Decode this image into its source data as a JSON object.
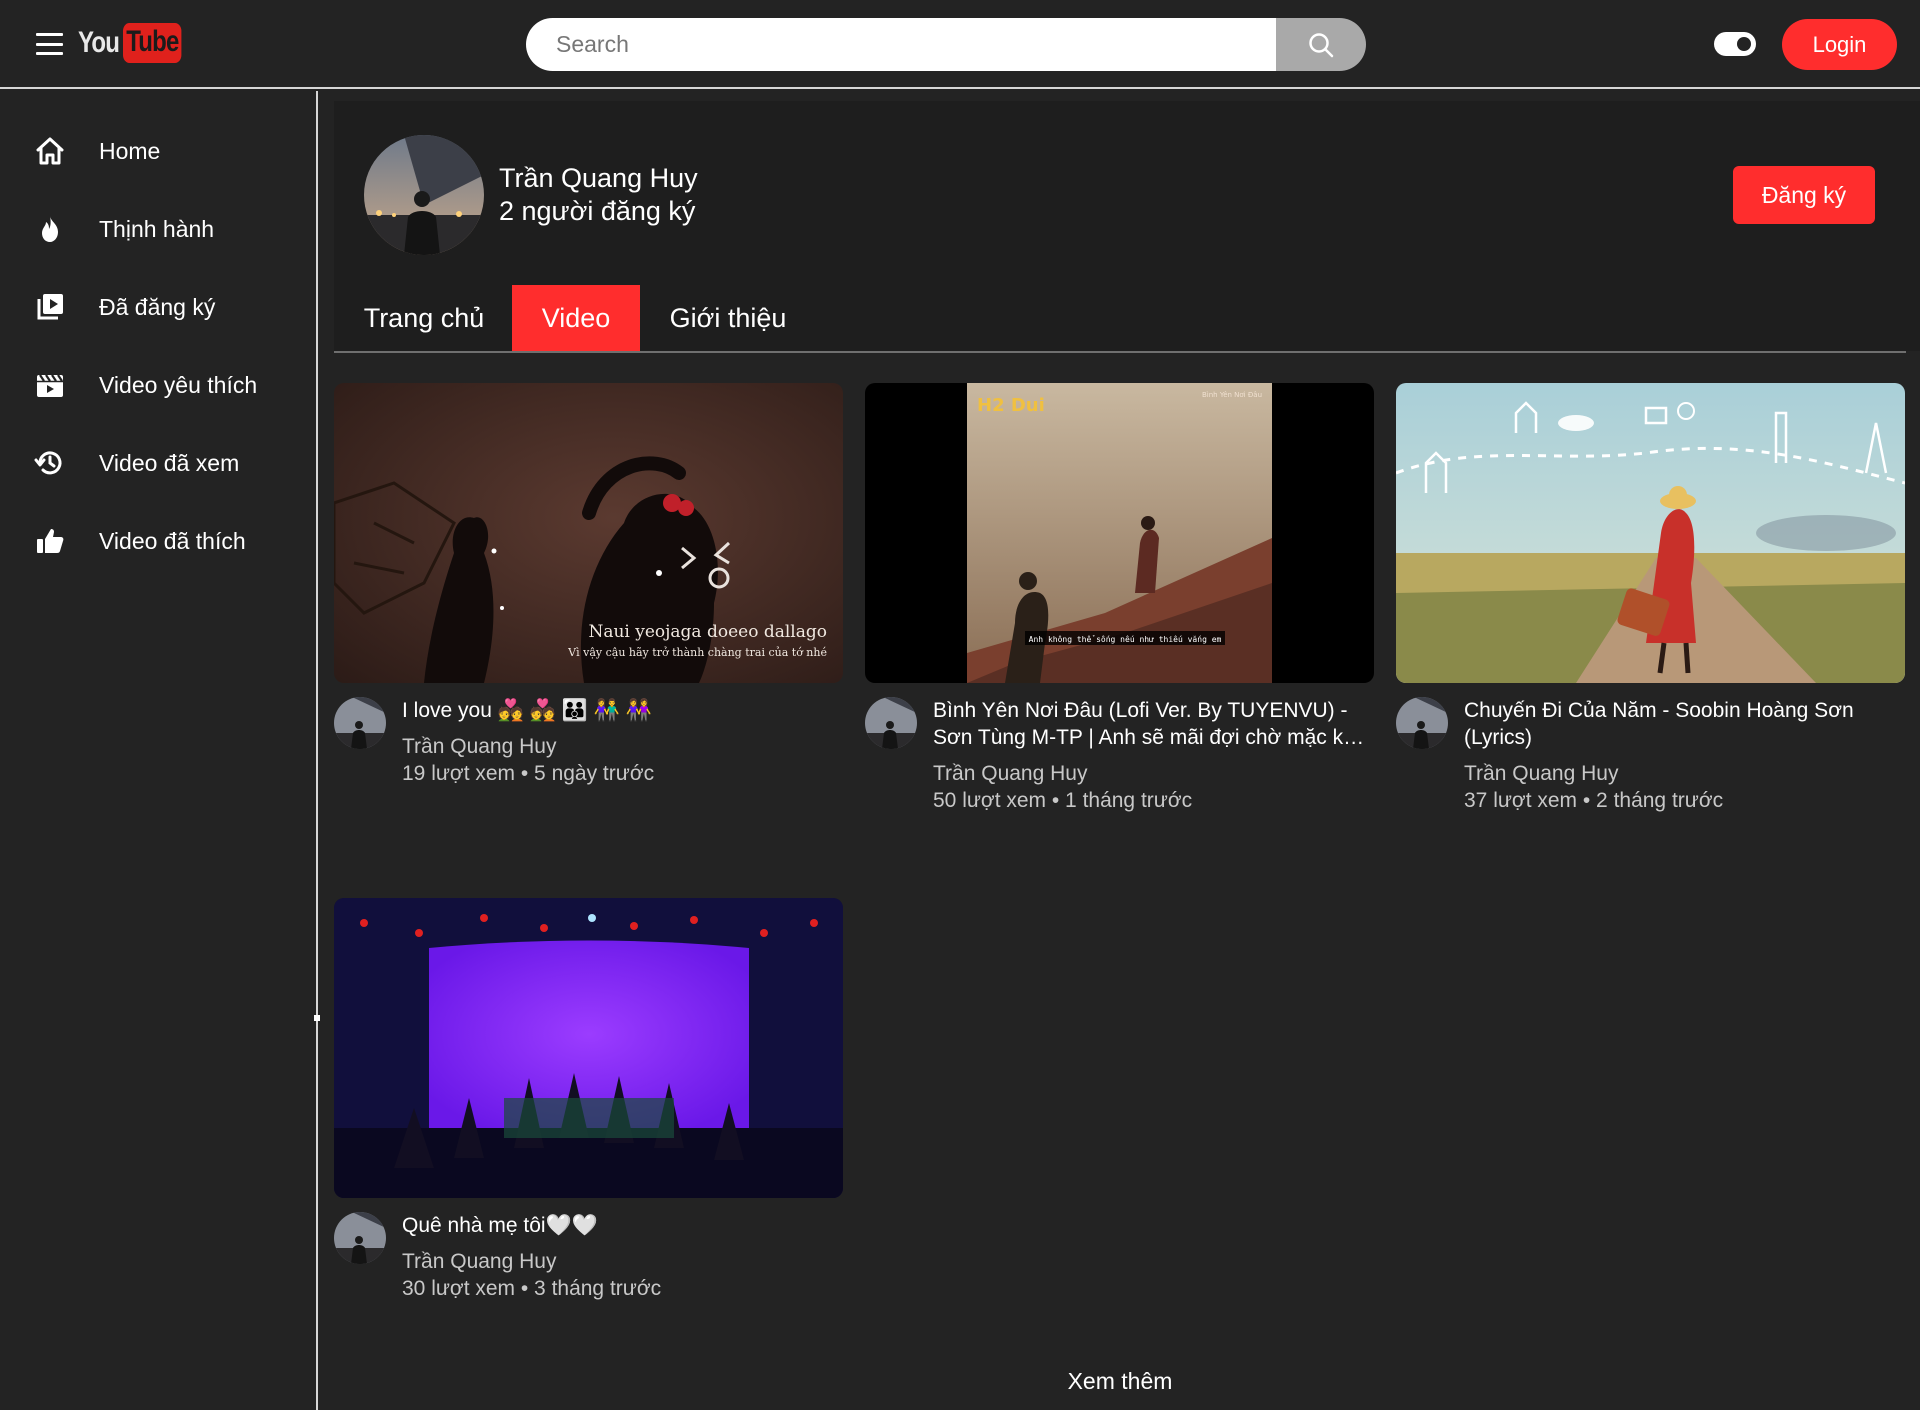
{
  "app": {
    "logo_you": "You",
    "logo_tube": "Tube",
    "search_placeholder": "Search",
    "login_label": "Login"
  },
  "sidebar": {
    "items": [
      {
        "label": "Home",
        "icon": "home-icon"
      },
      {
        "label": "Thịnh hành",
        "icon": "fire-icon"
      },
      {
        "label": "Đã đăng ký",
        "icon": "subscriptions-icon"
      },
      {
        "label": "Video yêu thích",
        "icon": "clapperboard-icon"
      },
      {
        "label": "Video đã xem",
        "icon": "history-icon"
      },
      {
        "label": "Video đã thích",
        "icon": "thumbs-up-icon"
      }
    ]
  },
  "channel": {
    "name": "Trần Quang Huy",
    "subscribers": "2 người đăng ký",
    "subscribe_label": "Đăng ký"
  },
  "tabs": [
    {
      "label": "Trang chủ",
      "active": false
    },
    {
      "label": "Video",
      "active": true
    },
    {
      "label": "Giới thiệu",
      "active": false
    }
  ],
  "videos": [
    {
      "title": "I love you 💑 💑 👪 👫 👭",
      "channel": "Trần Quang Huy",
      "meta": "19 lượt xem • 5 ngày trước",
      "thumb_caption_1": "Naui yeojaga doeeo dallago",
      "thumb_caption_2": "Vì vậy cậu hãy trở thành chàng trai của tớ nhé"
    },
    {
      "title": "Bình Yên Nơi Đâu (Lofi Ver. By TUYENVU) - Sơn Tùng M-TP | Anh sẽ mãi đợi chờ mặc kệ cho...",
      "channel": "Trần Quang Huy",
      "meta": "50 lượt xem • 1 tháng trước",
      "thumb_caption_1": "Anh không thể sống nếu như thiếu vắng em",
      "thumb_logo": "H2 Dui",
      "thumb_corner": "Bình Yên Nơi Đâu"
    },
    {
      "title": "Chuyến Đi Của Năm - Soobin Hoàng Sơn (Lyrics)",
      "channel": "Trần Quang Huy",
      "meta": "37 lượt xem • 2 tháng trước"
    },
    {
      "title": "Quê nhà mẹ tôi🤍🤍",
      "channel": "Trần Quang Huy",
      "meta": "30 lượt xem • 3 tháng trước"
    }
  ],
  "load_more_label": "Xem thêm",
  "colors": {
    "background": "#232323",
    "accent": "#ff2d2d",
    "text": "#ffffff",
    "muted_text": "#c8c8c8"
  }
}
